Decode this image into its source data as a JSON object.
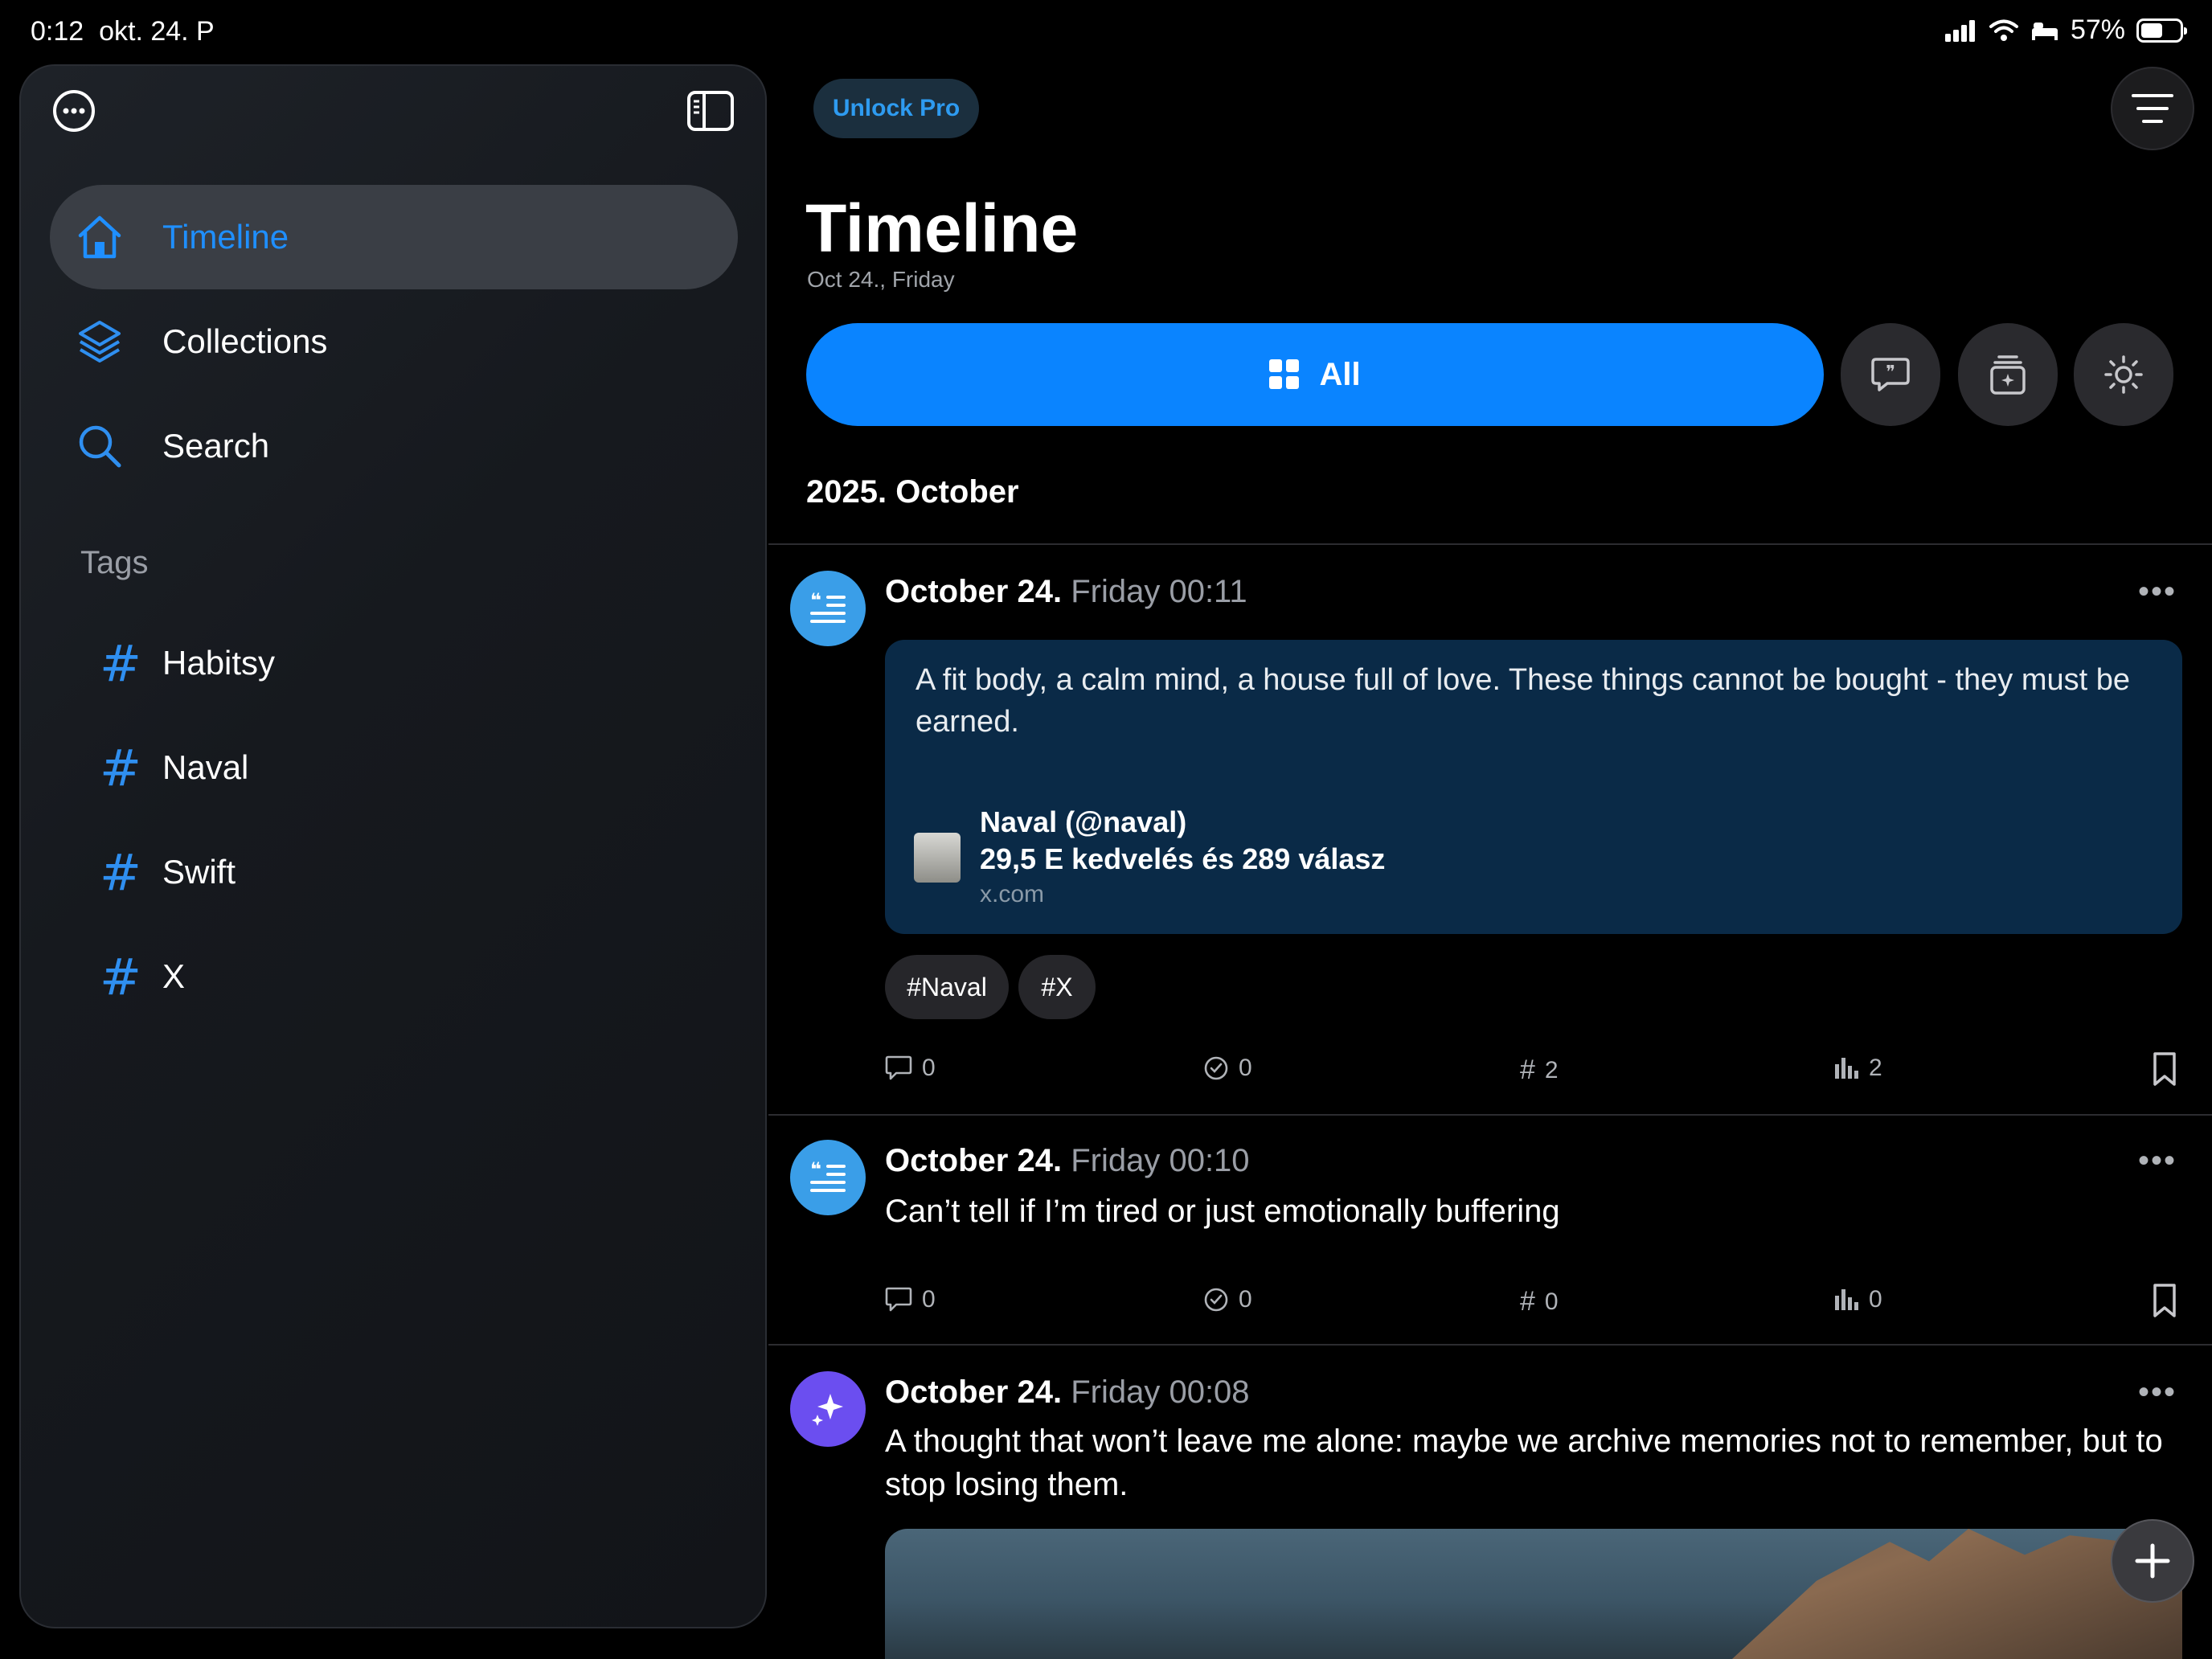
{
  "status_bar": {
    "time": "0:12",
    "date": "okt. 24. P",
    "battery_percent": "57%"
  },
  "sidebar": {
    "nav": [
      {
        "label": "Timeline",
        "icon": "home-icon",
        "active": true
      },
      {
        "label": "Collections",
        "icon": "layers-icon",
        "active": false
      },
      {
        "label": "Search",
        "icon": "search-icon",
        "active": false
      }
    ],
    "tags_header": "Tags",
    "tags": [
      {
        "hash": "#",
        "label": "Habitsy"
      },
      {
        "hash": "#",
        "label": "Naval"
      },
      {
        "hash": "#",
        "label": "Swift"
      },
      {
        "hash": "#",
        "label": "X"
      }
    ]
  },
  "header": {
    "unlock_label": "Unlock Pro",
    "title": "Timeline",
    "date": "Oct 24., Friday",
    "filter_all_label": "All",
    "month_label": "2025. October"
  },
  "entries": [
    {
      "date_bold": "October 24.",
      "date_rest": "Friday 00:11",
      "more": "•••",
      "quote": "A fit body, a calm mind, a house full of love. These things cannot be bought - they must be earned.",
      "link_title": "Naval (@naval)",
      "link_sub": "29,5 E kedvelés és 289 válasz",
      "link_domain": "x.com",
      "tags": [
        "#Naval",
        "#X"
      ],
      "stats": {
        "comments": "0",
        "checks": "0",
        "tags": "2",
        "views": "2"
      }
    },
    {
      "date_bold": "October 24.",
      "date_rest": "Friday 00:10",
      "more": "•••",
      "text": "Can’t tell if I’m tired or just emotionally buffering",
      "stats": {
        "comments": "0",
        "checks": "0",
        "tags": "0",
        "views": "0"
      }
    },
    {
      "date_bold": "October 24.",
      "date_rest": "Friday 00:08",
      "more": "•••",
      "text": "A thought that won’t leave me alone: maybe we archive memories not to remember, but to stop losing them."
    }
  ],
  "colors": {
    "accent": "#0a84ff",
    "tag_hash": "#2f8ff0",
    "quote_card": "#0a2a47",
    "ai_avatar": "#6b4ef0",
    "quote_avatar": "#3a9ee8"
  }
}
